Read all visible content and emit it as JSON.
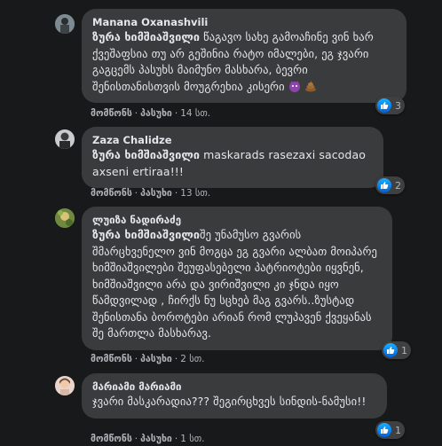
{
  "meta_actions": {
    "like": "მომწონს",
    "reply": "პასუხი"
  },
  "comments": [
    {
      "author": "Manana Oxanashvili",
      "mention": "ზურა ხიმშიაშვილი",
      "text": " წაგავო სახე გამოაჩინე ვინ ხარ ქვეშაფსია თუ არ გეშინია რატო იმალები, ეგ ჯვარი გაგცემს პასუხს მაიმუნო მასხარა, ბევრი შენისთანისთვის მოუგრეხია კისერი",
      "emojis": [
        "purple-devil-emoji",
        "poop-emoji"
      ],
      "time": "14 სთ.",
      "reactions": "3"
    },
    {
      "author": "Zaza Chalidze",
      "mention": "ზურა ხიმშიაშვილი",
      "text": " maskarads rasezaxi sacodao axseni ertiraa!!!",
      "time": "13 სთ.",
      "reactions": "2"
    },
    {
      "author": "ლუიზა ნადირაძე",
      "mention": "ზურა ხიმშიაშვილი",
      "text": "შე უნამუსო გვარის შმარცხვენელო ვინ მოგცა ეგ გვარი ალბათ მოიპარე ხიმშიაშვილები შეუფასებელი პატრიოტები იყვნენ, ხიმშიაშვილი არა და ვირიშვილი კი ჯნდა იყო წამდვილად , ჩირქს ნუ სცხებ მაგ გვარს..ზუსტად შენისთანა ბოროტები არიან რომ ლუპავენ ქვეყანას შე მართლა მასხარავ.",
      "time": "2 სთ.",
      "reactions": "1"
    },
    {
      "author": "მარიამი მარიამი",
      "mention": "",
      "text": "ჯვარი მასკარადია??? შეგირცხვეს სინდის-ნამუსი!!",
      "time": "1 სთ.",
      "reactions": "1"
    }
  ]
}
